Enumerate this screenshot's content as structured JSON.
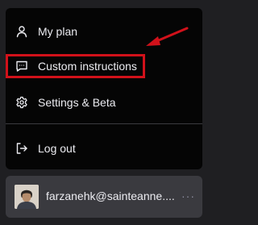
{
  "menu": {
    "items": [
      {
        "label": "My plan",
        "icon": "user-icon"
      },
      {
        "label": "Custom instructions",
        "icon": "message-square-icon"
      },
      {
        "label": "Settings & Beta",
        "icon": "gear-icon"
      },
      {
        "label": "Log out",
        "icon": "log-out-icon"
      }
    ]
  },
  "user": {
    "name": "farzanehk@sainteanne....",
    "more_label": "···"
  },
  "annotation": {
    "color": "#d1111a"
  }
}
